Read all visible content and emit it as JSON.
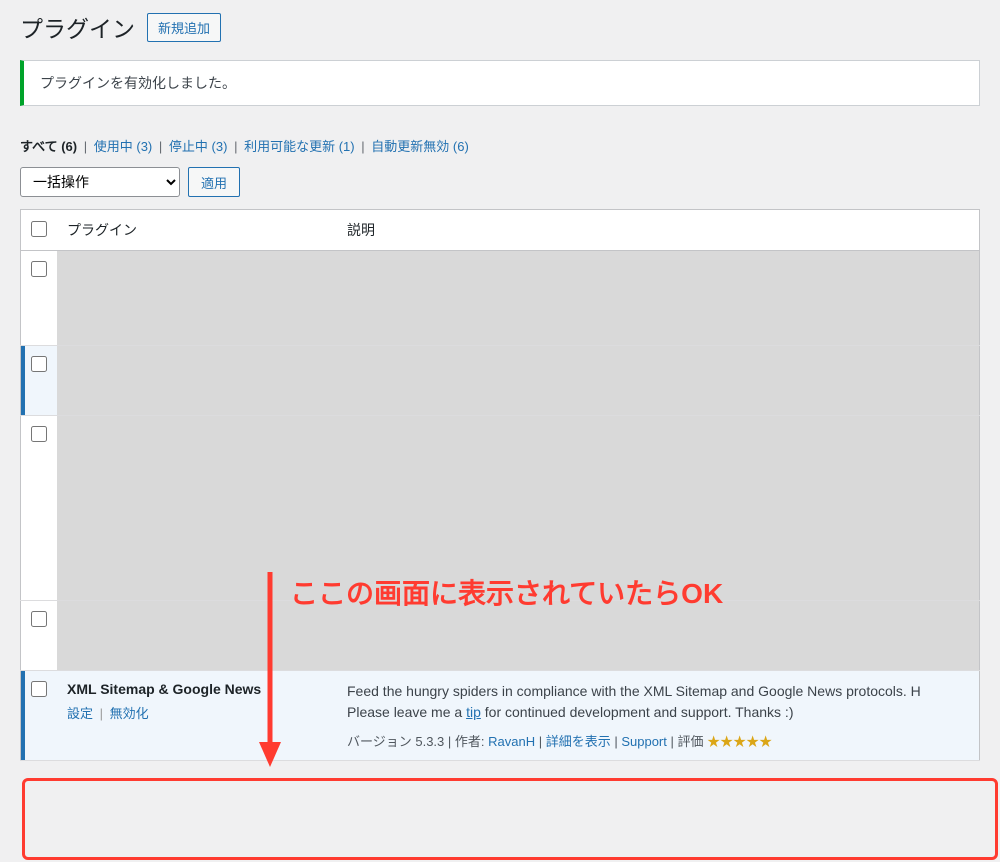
{
  "header": {
    "title": "プラグイン",
    "add_new": "新規追加"
  },
  "notice": {
    "message": "プラグインを有効化しました。"
  },
  "filters": {
    "all": {
      "label": "すべて",
      "count": "(6)"
    },
    "active": {
      "label": "使用中",
      "count": "(3)"
    },
    "inactive": {
      "label": "停止中",
      "count": "(3)"
    },
    "updates": {
      "label": "利用可能な更新",
      "count": "(1)"
    },
    "auto_disabled": {
      "label": "自動更新無効",
      "count": "(6)"
    }
  },
  "bulk": {
    "default_option": "一括操作",
    "apply": "適用"
  },
  "table": {
    "col_plugin": "プラグイン",
    "col_desc": "説明"
  },
  "plugin": {
    "name": "XML Sitemap & Google News",
    "action_settings": "設定",
    "action_deactivate": "無効化",
    "desc_pre": "Feed the hungry spiders in compliance with the XML Sitemap and Google News protocols. H",
    "desc_mid": "Please leave me a ",
    "desc_link": "tip",
    "desc_post": " for continued development and support. Thanks :)",
    "meta_version": "バージョン 5.3.3",
    "meta_author_label": "作者:",
    "meta_author": "RavanH",
    "meta_details": "詳細を表示",
    "meta_support": "Support",
    "meta_rating": "評価",
    "stars": "★★★★★"
  },
  "annotation": {
    "text": "ここの画面に表示されていたらOK"
  }
}
